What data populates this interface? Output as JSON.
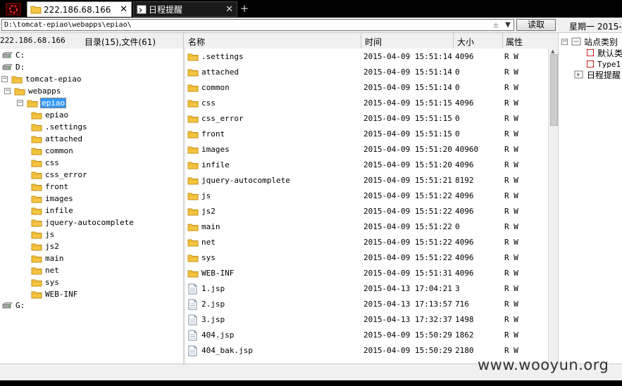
{
  "tabs": [
    {
      "label": "222.186.68.166",
      "icon": "folder-icon"
    },
    {
      "label": "日程提醒",
      "icon": "calendar-icon"
    }
  ],
  "path": {
    "value": "D:\\tomcat-epiao\\webapps\\epiao\\",
    "read_button": "读取"
  },
  "weekday": "星期一  2015-",
  "header": {
    "host": "222.186.68.166",
    "count": "目录(15),文件(61)",
    "columns": {
      "name": "名称",
      "time": "时间",
      "size": "大小",
      "attr": "属性"
    }
  },
  "tree": [
    {
      "label": "C:",
      "type": "drive",
      "level": 0
    },
    {
      "label": "D:",
      "type": "drive",
      "level": 0
    },
    {
      "label": "tomcat-epiao",
      "type": "folder",
      "level": 1,
      "expander": "-"
    },
    {
      "label": "webapps",
      "type": "folder",
      "level": 2,
      "expander": "-"
    },
    {
      "label": "epiao",
      "type": "folder",
      "level": 3,
      "expander": "-",
      "selected": true
    },
    {
      "label": "epiao",
      "type": "folder",
      "level": 4
    },
    {
      "label": ".settings",
      "type": "folder",
      "level": 4
    },
    {
      "label": "attached",
      "type": "folder",
      "level": 4
    },
    {
      "label": "common",
      "type": "folder",
      "level": 4
    },
    {
      "label": "css",
      "type": "folder",
      "level": 4
    },
    {
      "label": "css_error",
      "type": "folder",
      "level": 4
    },
    {
      "label": "front",
      "type": "folder",
      "level": 4
    },
    {
      "label": "images",
      "type": "folder",
      "level": 4
    },
    {
      "label": "infile",
      "type": "folder",
      "level": 4
    },
    {
      "label": "jquery-autocomplete",
      "type": "folder",
      "level": 4
    },
    {
      "label": "js",
      "type": "folder",
      "level": 4
    },
    {
      "label": "js2",
      "type": "folder",
      "level": 4
    },
    {
      "label": "main",
      "type": "folder",
      "level": 4
    },
    {
      "label": "net",
      "type": "folder",
      "level": 4
    },
    {
      "label": "sys",
      "type": "folder",
      "level": 4
    },
    {
      "label": "WEB-INF",
      "type": "folder",
      "level": 4
    },
    {
      "label": "G:",
      "type": "drive",
      "level": 0
    }
  ],
  "files": [
    {
      "name": ".settings",
      "time": "2015-04-09 15:51:14",
      "size": "4096",
      "attr": "R W",
      "type": "folder"
    },
    {
      "name": "attached",
      "time": "2015-04-09 15:51:14",
      "size": "0",
      "attr": "R W",
      "type": "folder"
    },
    {
      "name": "common",
      "time": "2015-04-09 15:51:14",
      "size": "0",
      "attr": "R W",
      "type": "folder"
    },
    {
      "name": "css",
      "time": "2015-04-09 15:51:15",
      "size": "4096",
      "attr": "R W",
      "type": "folder"
    },
    {
      "name": "css_error",
      "time": "2015-04-09 15:51:15",
      "size": "0",
      "attr": "R W",
      "type": "folder"
    },
    {
      "name": "front",
      "time": "2015-04-09 15:51:15",
      "size": "0",
      "attr": "R W",
      "type": "folder"
    },
    {
      "name": "images",
      "time": "2015-04-09 15:51:20",
      "size": "40960",
      "attr": "R W",
      "type": "folder"
    },
    {
      "name": "infile",
      "time": "2015-04-09 15:51:20",
      "size": "4096",
      "attr": "R W",
      "type": "folder"
    },
    {
      "name": "jquery-autocomplete",
      "time": "2015-04-09 15:51:21",
      "size": "8192",
      "attr": "R W",
      "type": "folder"
    },
    {
      "name": "js",
      "time": "2015-04-09 15:51:22",
      "size": "4096",
      "attr": "R W",
      "type": "folder"
    },
    {
      "name": "js2",
      "time": "2015-04-09 15:51:22",
      "size": "4096",
      "attr": "R W",
      "type": "folder"
    },
    {
      "name": "main",
      "time": "2015-04-09 15:51:22",
      "size": "0",
      "attr": "R W",
      "type": "folder"
    },
    {
      "name": "net",
      "time": "2015-04-09 15:51:22",
      "size": "4096",
      "attr": "R W",
      "type": "folder"
    },
    {
      "name": "sys",
      "time": "2015-04-09 15:51:22",
      "size": "4096",
      "attr": "R W",
      "type": "folder"
    },
    {
      "name": "WEB-INF",
      "time": "2015-04-09 15:51:31",
      "size": "4096",
      "attr": "R W",
      "type": "folder"
    },
    {
      "name": "1.jsp",
      "time": "2015-04-13 17:04:21",
      "size": "3",
      "attr": "R W",
      "type": "file"
    },
    {
      "name": "2.jsp",
      "time": "2015-04-13 17:13:57",
      "size": "716",
      "attr": "R W",
      "type": "file"
    },
    {
      "name": "3.jsp",
      "time": "2015-04-13 17:32:37",
      "size": "1498",
      "attr": "R W",
      "type": "file"
    },
    {
      "name": "404.jsp",
      "time": "2015-04-09 15:50:29",
      "size": "1862",
      "attr": "R W",
      "type": "file"
    },
    {
      "name": "404_bak.jsp",
      "time": "2015-04-09 15:50:29",
      "size": "2180",
      "attr": "R W",
      "type": "file"
    }
  ],
  "right_panel": {
    "root": "站点类别",
    "items": [
      "默认类",
      "Type1"
    ],
    "schedule": "日程提醒"
  },
  "watermark": "www.wooyun.org",
  "colors": {
    "selection": "#3399ff",
    "folder": "#f5c542",
    "tab_bar": "#000000",
    "marker": "#cc0000"
  }
}
